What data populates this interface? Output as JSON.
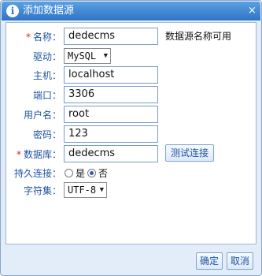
{
  "dialog": {
    "title": "添加数据源",
    "title_icon": "i",
    "close_symbol": "×"
  },
  "form": {
    "name": {
      "label": "名称：",
      "value": "dedecms",
      "required": "*",
      "hint": "数据源名称可用"
    },
    "driver": {
      "label": "驱动：",
      "value": "MySQL"
    },
    "host": {
      "label": "主机：",
      "value": "localhost"
    },
    "port": {
      "label": "端口：",
      "value": "3306"
    },
    "user": {
      "label": "用户名：",
      "value": "root"
    },
    "password": {
      "label": "密码：",
      "value": "123"
    },
    "database": {
      "label": "数据库：",
      "value": "dedecms",
      "required": "*"
    },
    "test_button": "测试连接",
    "persistent": {
      "label": "持久连接：",
      "option_yes": "是",
      "option_no": "否",
      "selected": "否"
    },
    "charset": {
      "label": "字符集：",
      "value": "UTF-8"
    }
  },
  "footer": {
    "ok": "确定",
    "cancel": "取消"
  },
  "colors": {
    "titlebar": "#2f74c5",
    "label": "#1f54a3",
    "required": "#e02020"
  }
}
